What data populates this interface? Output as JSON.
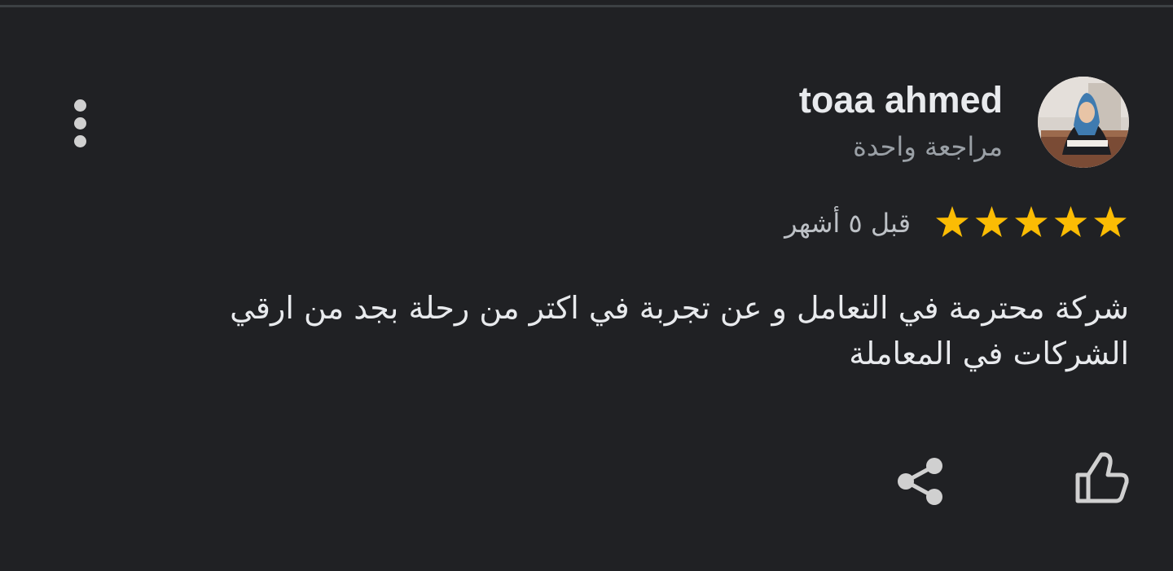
{
  "review": {
    "author_name": "toaa ahmed",
    "review_count": "مراجعة واحدة",
    "rating": 5,
    "rating_max": 5,
    "time_ago": "قبل ٥ أشهر",
    "text": "شركة محترمة في التعامل و عن تجربة في اكتر من رحلة بجد من ارقي الشركات في المعاملة"
  },
  "icons": {
    "more": "more-vertical-icon",
    "star": "star-icon",
    "share": "share-icon",
    "like": "thumbs-up-icon",
    "avatar": "user-avatar"
  },
  "colors": {
    "background": "#202124",
    "star": "#fbbc04",
    "primary_text": "#e8eaed",
    "secondary_text": "#9aa0a6",
    "icon": "#d0d0d0"
  }
}
